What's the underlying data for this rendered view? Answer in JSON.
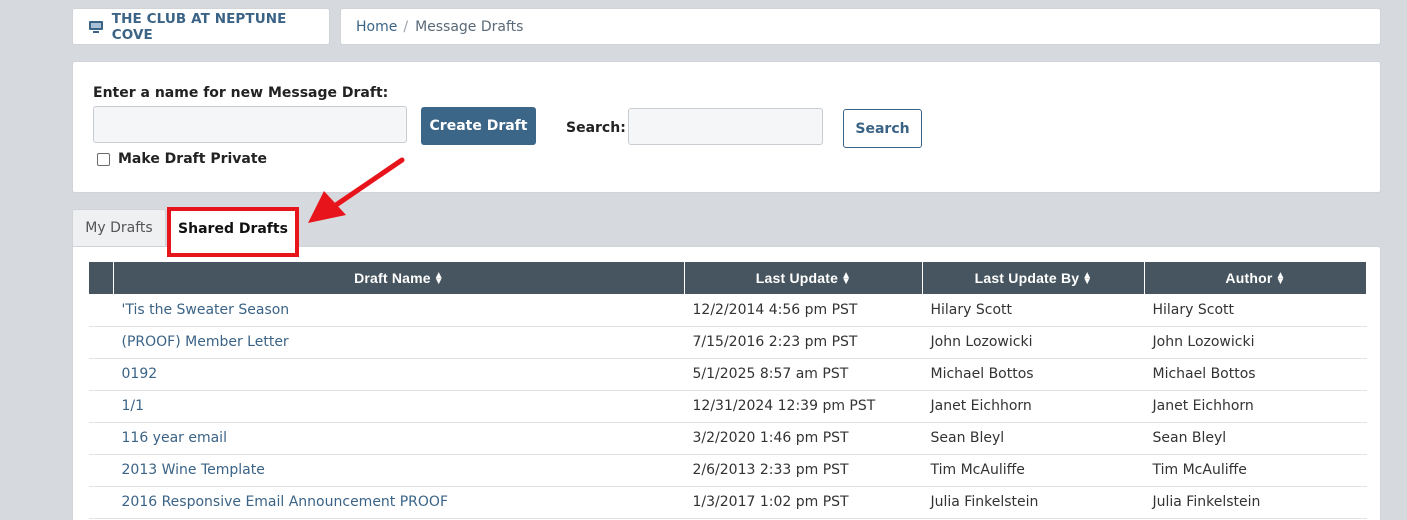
{
  "header": {
    "brand": "THE CLUB AT NEPTUNE COVE",
    "breadcrumb": {
      "home": "Home",
      "separator": "/",
      "current": "Message Drafts"
    }
  },
  "form": {
    "name_label": "Enter a name for new Message Draft:",
    "name_value": "",
    "create_label": "Create Draft",
    "search_label": "Search:",
    "search_value": "",
    "search_button": "Search",
    "private_label": "Make Draft Private",
    "private_checked": false
  },
  "tabs": [
    {
      "label": "My Drafts",
      "active": false
    },
    {
      "label": "Shared Drafts",
      "active": true
    }
  ],
  "table": {
    "columns": [
      "Draft Name",
      "Last Update",
      "Last Update By",
      "Author"
    ],
    "rows": [
      {
        "name": "'Tis the Sweater Season",
        "updated": "12/2/2014 4:56 pm PST",
        "updated_by": "Hilary Scott",
        "author": "Hilary Scott"
      },
      {
        "name": "(PROOF) Member Letter",
        "updated": "7/15/2016 2:23 pm PST",
        "updated_by": "John Lozowicki",
        "author": "John Lozowicki"
      },
      {
        "name": "0192",
        "updated": "5/1/2025 8:57 am PST",
        "updated_by": "Michael Bottos",
        "author": "Michael Bottos"
      },
      {
        "name": "1/1",
        "updated": "12/31/2024 12:39 pm PST",
        "updated_by": "Janet Eichhorn",
        "author": "Janet Eichhorn"
      },
      {
        "name": "116 year email",
        "updated": "3/2/2020 1:46 pm PST",
        "updated_by": "Sean Bleyl",
        "author": "Sean Bleyl"
      },
      {
        "name": "2013 Wine Template",
        "updated": "2/6/2013 2:33 pm PST",
        "updated_by": "Tim McAuliffe",
        "author": "Tim McAuliffe"
      },
      {
        "name": "2016 Responsive Email Announcement PROOF",
        "updated": "1/3/2017 1:02 pm PST",
        "updated_by": "Julia Finkelstein",
        "author": "Julia Finkelstein"
      }
    ]
  },
  "colors": {
    "primary": "#3c6688",
    "table_header": "#46555f",
    "highlight": "#e8141c",
    "background": "#d6dade"
  },
  "icons": {
    "brand": "monitor-icon",
    "sort": "sort-icon",
    "annotation": "red-arrow-icon"
  }
}
